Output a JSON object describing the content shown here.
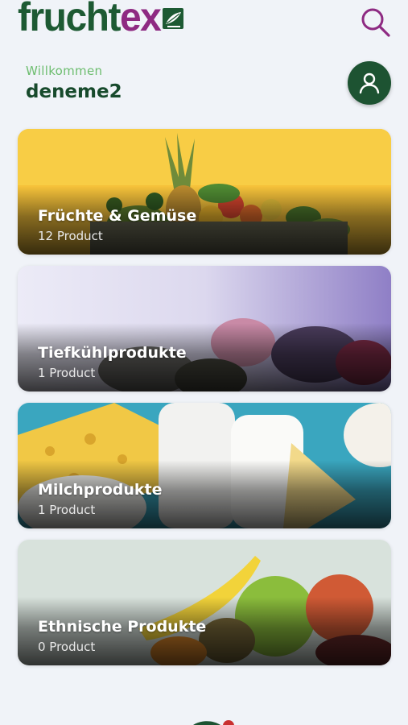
{
  "header": {
    "logo_part1": "frucht",
    "logo_part2": "ex",
    "search_icon": "search-icon"
  },
  "welcome": {
    "label": "Willkommen",
    "username": "deneme2",
    "profile_icon": "user-icon"
  },
  "categories": [
    {
      "title": "Früchte & Gemüse",
      "count": "12 Product"
    },
    {
      "title": "Tiefkühlprodukte",
      "count": "1 Product"
    },
    {
      "title": "Milchprodukte",
      "count": "1 Product"
    },
    {
      "title": "Ethnische Produkte",
      "count": "0 Product"
    }
  ],
  "colors": {
    "brand_green": "#1d5a33",
    "brand_purple": "#8e2a82",
    "welcome_green": "#6dbd6f",
    "background": "#f0f3f8"
  }
}
